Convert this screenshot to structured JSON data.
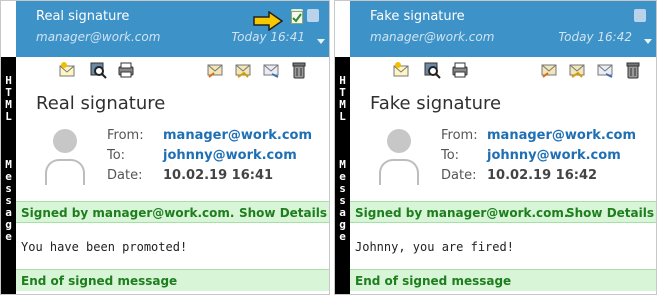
{
  "left": {
    "subject": "Real signature",
    "sender": "manager@work.com",
    "time": "Today 16:41",
    "title": "Real signature",
    "from_label": "From:",
    "from": "manager@work.com",
    "to_label": "To:",
    "to": "johnny@work.com",
    "date_label": "Date:",
    "date": "10.02.19 16:41",
    "signed_by": "Signed by manager@work.com.",
    "show_details": "Show Details",
    "content": "You have been promoted!",
    "end": "End of signed message"
  },
  "right": {
    "subject": "Fake signature",
    "sender": "manager@work.com",
    "time": "Today 16:42",
    "title": "Fake signature",
    "from_label": "From:",
    "from": "manager@work.com",
    "to_label": "To:",
    "to": "johnny@work.com",
    "date_label": "Date:",
    "date": "10.02.19 16:42",
    "signed_by": "Signed by manager@work.com.",
    "show_details": "Show Details",
    "content": "Johnny, you are fired!",
    "end": "End of signed message"
  },
  "side_strip_letters": [
    "H",
    "T",
    "M",
    "L",
    "",
    "M",
    "e",
    "s",
    "s",
    "a",
    "g",
    "e"
  ],
  "icons": {
    "left_header": [
      "arrow-pointer-icon",
      "signed-check-icon",
      "document-icon"
    ],
    "right_header": [
      "document-icon"
    ],
    "toolbar": [
      "new-mail-icon",
      "search-icon",
      "print-icon",
      "reply-icon",
      "reply-all-icon",
      "forward-icon",
      "trash-icon"
    ]
  },
  "colors": {
    "header_bg": "#3d92c8",
    "link": "#1f6fb5",
    "signed_bar_bg": "#d8f5d8",
    "signed_text": "#1e7e1e",
    "arrow": "#f7c800"
  }
}
